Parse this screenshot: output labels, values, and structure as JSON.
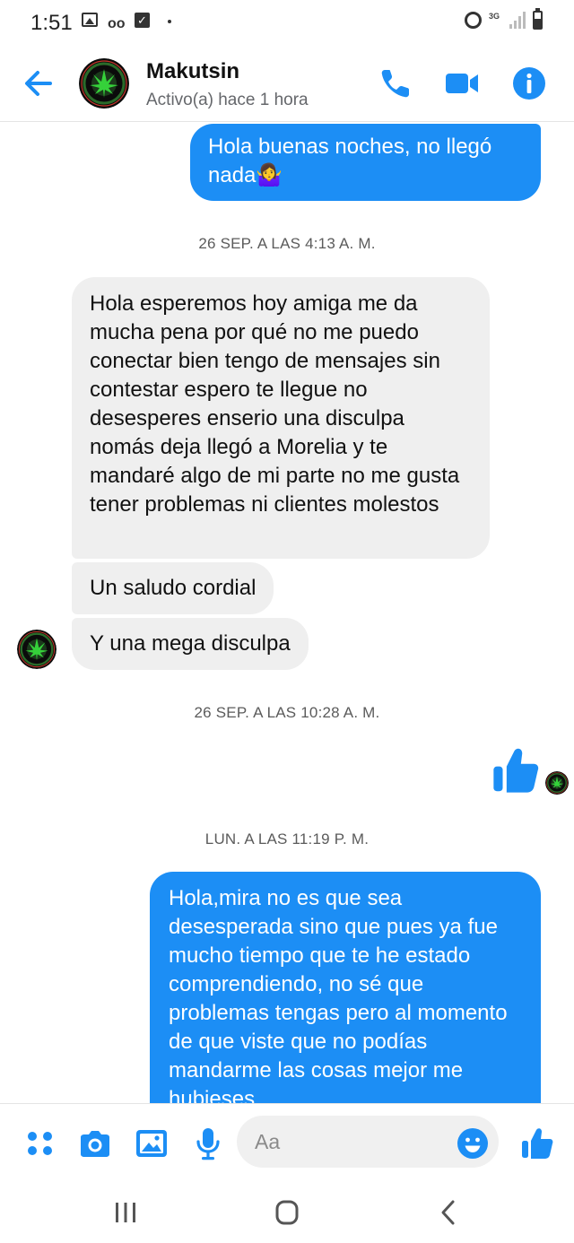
{
  "status_bar": {
    "time": "1:51",
    "network": "3G"
  },
  "header": {
    "contact_name": "Makutsin",
    "contact_status": "Activo(a) hace 1 hora"
  },
  "messages": [
    {
      "kind": "out",
      "text": "Hola buenas noches, no llegó nada🤷‍♀️"
    },
    {
      "kind": "timestamp",
      "text": "26 SEP. A LAS 4:13 A. M."
    },
    {
      "kind": "in",
      "text": "Hola esperemos hoy amiga me da mucha pena por qué no me puedo conectar bien tengo de mensajes sin contestar espero te llegue no desesperes enserio una disculpa nomás deja llegó a Morelia y te mandaré algo de mi parte no me gusta tener problemas ni clientes molestos"
    },
    {
      "kind": "in",
      "text": "Un saludo cordial"
    },
    {
      "kind": "in",
      "text": "Y una mega disculpa"
    },
    {
      "kind": "timestamp",
      "text": "26 SEP. A LAS 10:28 A. M."
    },
    {
      "kind": "like"
    },
    {
      "kind": "timestamp",
      "text": "LUN. A LAS 11:19 P. M."
    },
    {
      "kind": "out",
      "text": "Hola,mira no es que sea desesperada sino que pues ya fue mucho tiempo que te he estado comprendiendo, no sé que problemas tengas pero al momento de que viste que no podías mandarme las cosas mejor me hubieses"
    }
  ],
  "composer": {
    "placeholder": "Aa"
  },
  "colors": {
    "accent": "#1c8ef5",
    "incoming_bubble": "#efefef",
    "timestamp": "#5b5b5b"
  },
  "icons": [
    "back-arrow-icon",
    "phone-icon",
    "video-camera-icon",
    "info-icon",
    "apps-grid-icon",
    "camera-icon",
    "gallery-icon",
    "microphone-icon",
    "emoji-icon",
    "thumbs-up-icon",
    "recents-icon",
    "home-icon",
    "back-icon"
  ]
}
